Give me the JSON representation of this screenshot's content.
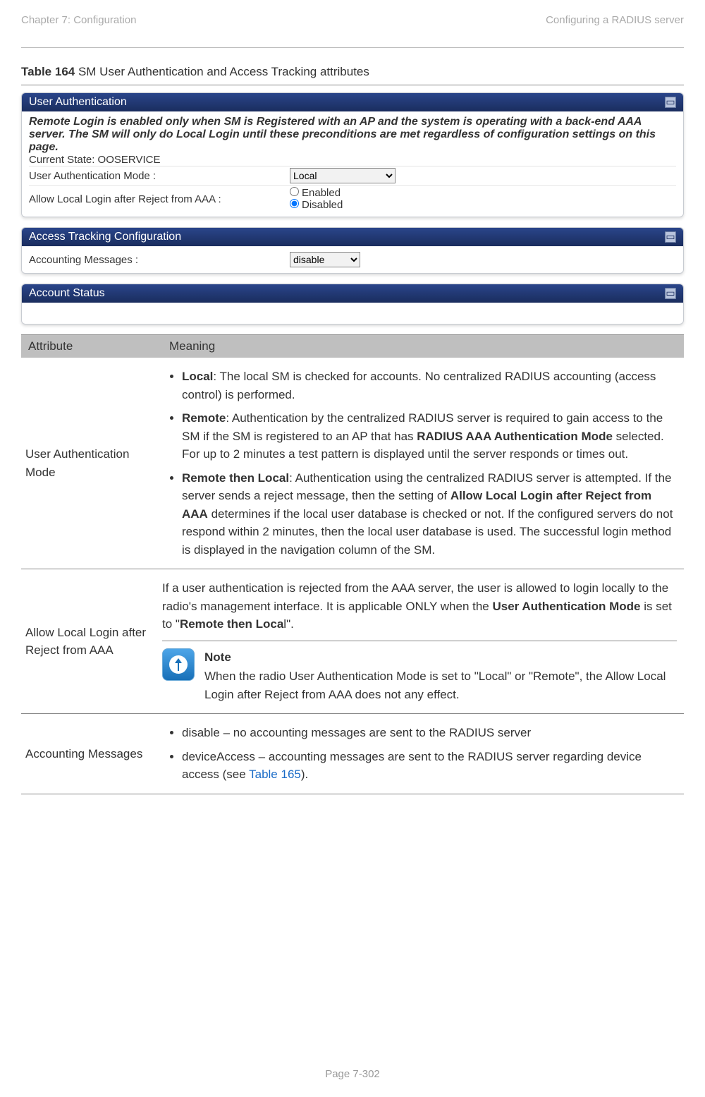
{
  "header": {
    "left": "Chapter 7:  Configuration",
    "right": "Configuring a RADIUS server"
  },
  "caption": {
    "label": "Table 164",
    "title": " SM User Authentication and Access Tracking attributes"
  },
  "panels": {
    "userAuth": {
      "title": "User Authentication",
      "intro": "Remote Login is enabled only when SM is Registered with an AP and the system is operating with a back-end AAA server. The SM will only do Local Login until these preconditions are met regardless of configuration settings on this page.",
      "stateLabel": "Current State: OOSERVICE",
      "modeLabel": "User Authentication Mode :",
      "modeValue": "Local",
      "allowLabel": "Allow Local Login after Reject from AAA :",
      "enabled": "Enabled",
      "disabled": "Disabled"
    },
    "accessTracking": {
      "title": "Access Tracking Configuration",
      "acctLabel": "Accounting Messages :",
      "acctValue": "disable"
    },
    "accountStatus": {
      "title": "Account Status"
    }
  },
  "table": {
    "headers": {
      "col1": "Attribute",
      "col2": "Meaning"
    },
    "row1": {
      "attr": "User Authentication Mode",
      "local_b": "Local",
      "local_rest": ": The local SM is checked for accounts. No centralized RADIUS accounting (access control) is performed.",
      "remote_b": "Remote",
      "remote_rest1": ": Authentication by the centralized RADIUS server is required to gain access to the SM if the SM is registered to an AP that has ",
      "remote_b2": "RADIUS AAA Authentication Mode",
      "remote_rest2": " selected. For up to 2 minutes a test pattern is displayed until the server responds or times out.",
      "rtl_b": "Remote then Local",
      "rtl_rest1": ": Authentication using the centralized RADIUS server is attempted. If the server sends a reject message, then the setting of ",
      "rtl_b2": "Allow Local Login after Reject from AAA",
      "rtl_rest2": " determines if the local user database is checked or not. If the configured servers do not respond within 2 minutes, then the local user database is used. The successful login method is displayed in the navigation column of the SM."
    },
    "row2": {
      "attr": "Allow Local Login after Reject from AAA",
      "p1a": "If a user authentication is rejected from the AAA server, the user is allowed to login locally to the radio's management interface. It is applicable ONLY when the ",
      "p1b": "User Authentication Mode",
      "p1c": " is set to \"",
      "p1d": "Remote then Loca",
      "p1e": "l\".",
      "noteTitle": "Note",
      "noteBody": "When the radio User Authentication Mode is set to \"Local\" or \"Remote\", the Allow Local Login after Reject from AAA does not any effect."
    },
    "row3": {
      "attr": "Accounting Messages",
      "b1": "disable – no accounting messages are sent to the RADIUS server",
      "b2a": "deviceAccess – accounting messages are sent to the RADIUS server regarding device access (see ",
      "b2link": "Table 165",
      "b2b": ")."
    }
  },
  "footer": "Page 7-302"
}
